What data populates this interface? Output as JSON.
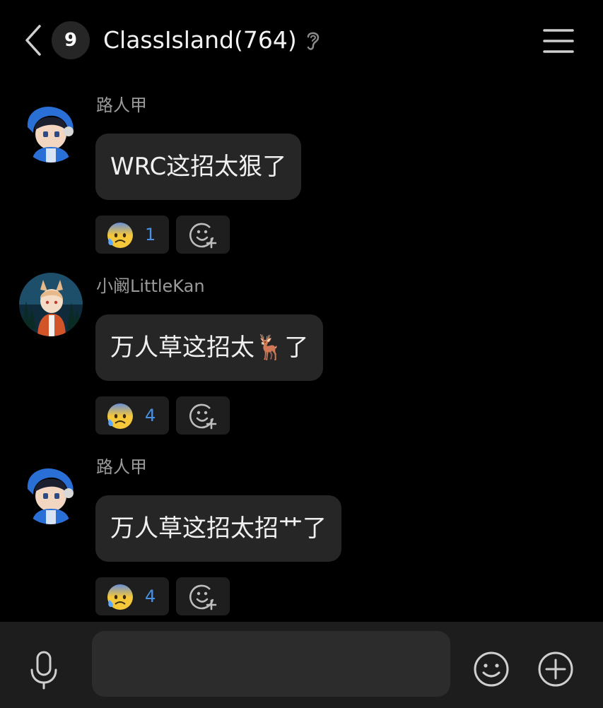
{
  "header": {
    "unread_count": "9",
    "title": "ClassIsland(764)",
    "back_icon": "chevron-left-icon",
    "ear_icon": "ear-icon",
    "menu_icon": "hamburger-menu-icon"
  },
  "messages": [
    {
      "sender": "路人甲",
      "text": "WRC这招太狠了",
      "reaction": {
        "emoji": "anxious-face-with-sweat",
        "count": "1"
      },
      "avatar": "blue-hoodie-boy-avatar"
    },
    {
      "sender": "小阚LittleKan",
      "text": "万人草这招太🦌了",
      "reaction": {
        "emoji": "anxious-face-with-sweat",
        "count": "4"
      },
      "avatar": "fox-eared-boy-forest-avatar"
    },
    {
      "sender": "路人甲",
      "text": "万人草这招太招艹了",
      "reaction": {
        "emoji": "anxious-face-with-sweat",
        "count": "4"
      },
      "avatar": "blue-hoodie-boy-avatar"
    }
  ],
  "input": {
    "value": "",
    "placeholder": "",
    "mic_icon": "microphone-icon",
    "emoji_icon": "smiley-face-icon",
    "plus_icon": "plus-circle-icon"
  },
  "colors": {
    "background": "#000000",
    "bubble": "#262626",
    "reaction_count": "#4a90e2",
    "sender_name": "#9a9a9a"
  }
}
